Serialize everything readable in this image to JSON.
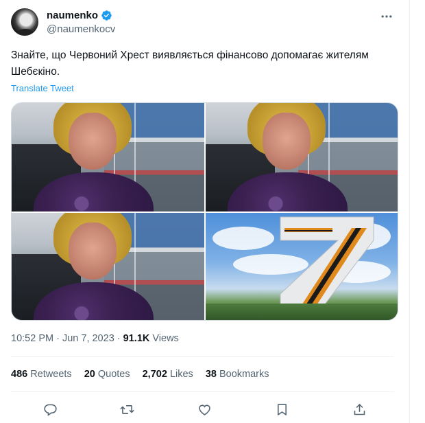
{
  "author": {
    "display_name": "naumenko",
    "handle": "@naumenkocv",
    "verified": true,
    "avatar": "avatar"
  },
  "tweet": {
    "text": "Знайте, що Червоний Хрест виявляється фінансово допомагає жителям Шебєкіно.",
    "translate_label": "Translate Tweet"
  },
  "meta": {
    "time": "10:52 PM",
    "date": "Jun 7, 2023",
    "views_count": "91.1K",
    "views_label": "Views"
  },
  "stats": {
    "retweets_count": "486",
    "retweets_label": "Retweets",
    "quotes_count": "20",
    "quotes_label": "Quotes",
    "likes_count": "2,702",
    "likes_label": "Likes",
    "bookmarks_count": "38",
    "bookmarks_label": "Bookmarks"
  },
  "actions": [
    "reply-icon",
    "retweet-icon",
    "like-icon",
    "bookmark-icon",
    "share-icon"
  ],
  "colors": {
    "accent": "#1d9bf0",
    "text_primary": "#0f1419",
    "text_secondary": "#536471",
    "divider": "#eff3f4"
  }
}
